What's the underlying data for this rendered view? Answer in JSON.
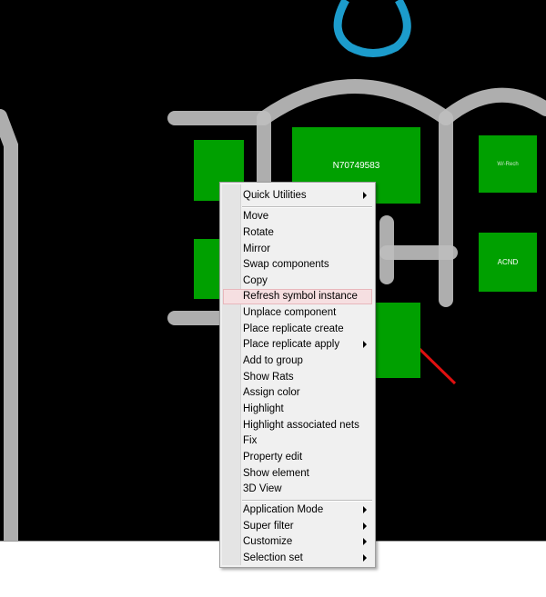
{
  "canvas": {
    "background": "#000000",
    "trace_color": "#c0c0c0",
    "ring_color": "#1c9ccc",
    "pad_color": "#00a000",
    "components": [
      {
        "id": "pad-1",
        "label": ""
      },
      {
        "id": "pad-2",
        "label": "N70749583"
      },
      {
        "id": "pad-3",
        "label": "W/-Rech"
      },
      {
        "id": "pad-4",
        "label": ""
      },
      {
        "id": "pad-5",
        "label": "ACND"
      },
      {
        "id": "pad-6",
        "label": ""
      }
    ]
  },
  "context_menu": {
    "highlight_color": "#f6dfe1",
    "items": [
      {
        "label": "Quick Utilities",
        "submenu": true
      },
      {
        "label": "Move",
        "submenu": false
      },
      {
        "label": "Rotate",
        "submenu": false
      },
      {
        "label": "Mirror",
        "submenu": false
      },
      {
        "label": "Swap components",
        "submenu": false
      },
      {
        "label": "Copy",
        "submenu": false
      },
      {
        "label": "Refresh symbol instance",
        "submenu": false,
        "highlighted": true
      },
      {
        "label": "Unplace component",
        "submenu": false
      },
      {
        "label": "Place replicate create",
        "submenu": false
      },
      {
        "label": "Place replicate apply",
        "submenu": true
      },
      {
        "label": "Add to group",
        "submenu": false
      },
      {
        "label": "Show Rats",
        "submenu": false
      },
      {
        "label": "Assign color",
        "submenu": false
      },
      {
        "label": "Highlight",
        "submenu": false
      },
      {
        "label": "Highlight associated nets",
        "submenu": false
      },
      {
        "label": "Fix",
        "submenu": false
      },
      {
        "label": "Property edit",
        "submenu": false
      },
      {
        "label": "Show element",
        "submenu": false
      },
      {
        "label": "3D View",
        "submenu": false
      },
      {
        "label": "Application Mode",
        "submenu": true
      },
      {
        "label": "Super filter",
        "submenu": true
      },
      {
        "label": "Customize",
        "submenu": true
      },
      {
        "label": "Selection set",
        "submenu": true
      }
    ]
  },
  "annotation": {
    "arrow_color": "#e01010"
  }
}
